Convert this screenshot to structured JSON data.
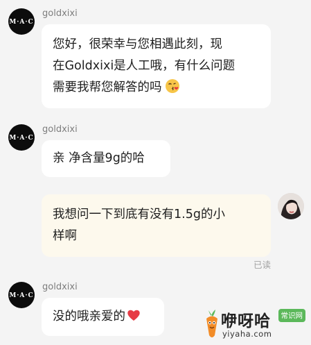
{
  "messages": [
    {
      "sender": "goldxixi",
      "lines": [
        "您好，很荣幸与您相遇此刻，现",
        "在Goldxixi是人工哦，有什么问题",
        "需要我帮您解答的吗"
      ],
      "emoji": "kissing-face-emoji"
    },
    {
      "sender": "goldxixi",
      "lines": [
        "亲 净含量9g的哈"
      ]
    },
    {
      "sender": "me",
      "lines": [
        "我想问一下到底有没有1.5g的小",
        "样啊"
      ],
      "status": "已读"
    },
    {
      "sender": "goldxixi",
      "lines": [
        "没的哦亲爱的"
      ],
      "emoji": "red-heart-emoji"
    }
  ],
  "watermark": {
    "title": "咿呀哈",
    "badge": "常识网",
    "url": "yiyaha.com",
    "icon": "carrot-mascot-icon"
  },
  "colors": {
    "background": "#f4f4f4",
    "incoming_bubble": "#ffffff",
    "outgoing_bubble": "#fdf9ed",
    "avatar": "#0c0c0c",
    "watermark_green": "#5bb85a"
  }
}
